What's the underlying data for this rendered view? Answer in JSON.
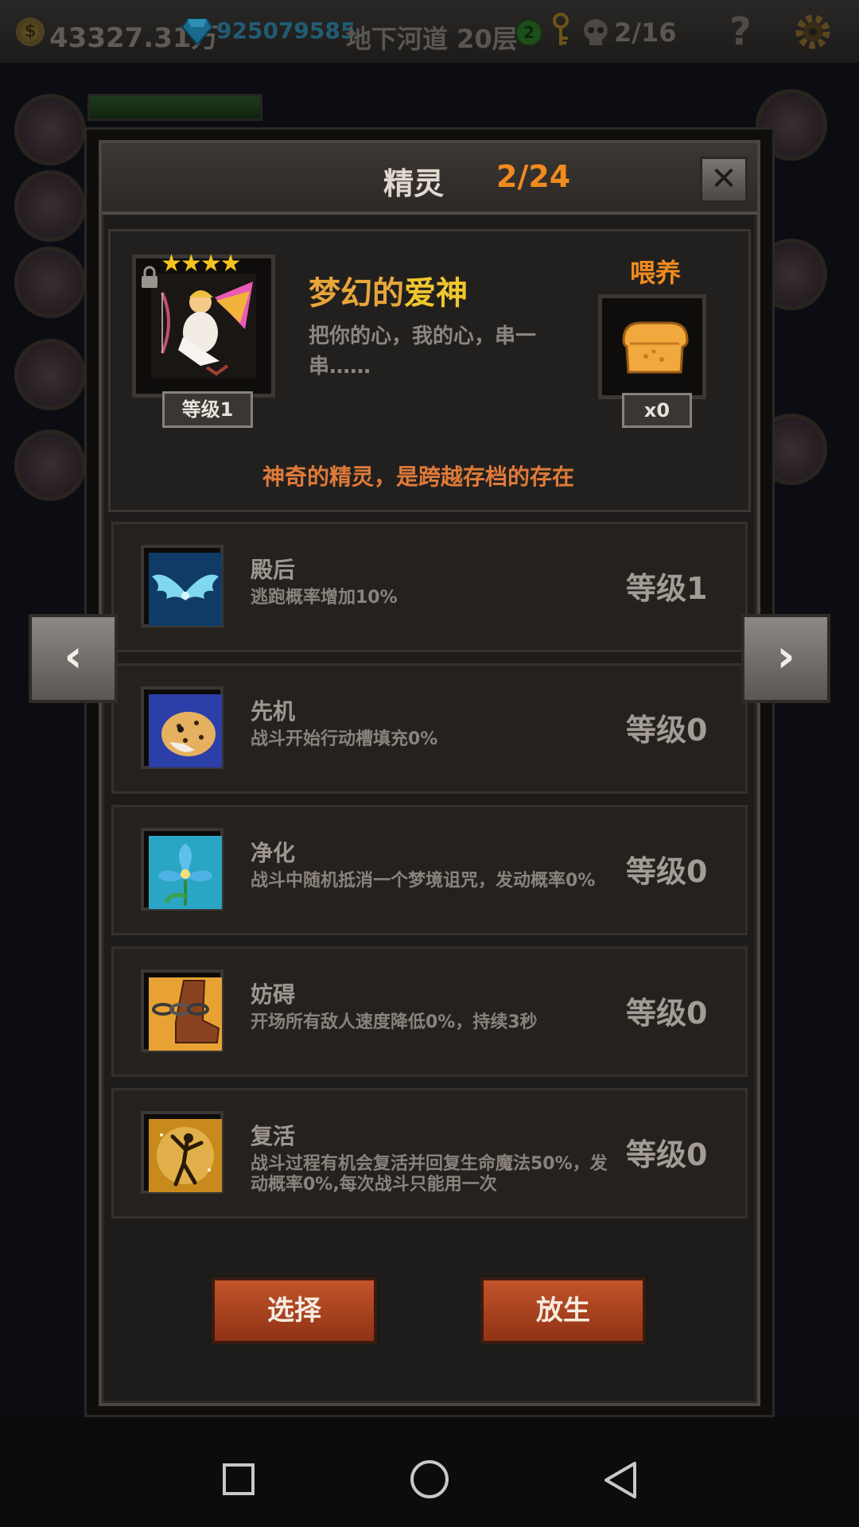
{
  "hud": {
    "coin_symbol": "$",
    "gold": "43327.31万",
    "gems": "925079585",
    "floor": "地下河道 20层",
    "badge_number": "2",
    "kills": "2/16",
    "help_symbol": "?"
  },
  "panel": {
    "title": "精灵",
    "count": "2/24",
    "close_symbol": "✕"
  },
  "sprite": {
    "stars": "★★★★",
    "level_badge": "等级1",
    "name_prefix": "梦幻的",
    "name_suffix": "爱神",
    "description": "把你的心，我的心，串一串……",
    "feed_label": "喂养",
    "feed_count": "x0",
    "tagline": "神奇的精灵，是跨越存档的存在"
  },
  "skills": [
    {
      "name": "殿后",
      "desc": "逃跑概率增加10%",
      "level": "等级1",
      "icon": "wings-icon"
    },
    {
      "name": "先机",
      "desc": "战斗开始行动槽填充0%",
      "level": "等级0",
      "icon": "leopard-icon"
    },
    {
      "name": "净化",
      "desc": "战斗中随机抵消一个梦境诅咒，发动概率0%",
      "level": "等级0",
      "icon": "flower-icon"
    },
    {
      "name": "妨碍",
      "desc": "开场所有敌人速度降低0%，持续3秒",
      "level": "等级0",
      "icon": "chained-boot-icon"
    },
    {
      "name": "复活",
      "desc": "战斗过程有机会复活并回复生命魔法50%，发动概率0%,每次战斗只能用一次",
      "level": "等级0",
      "icon": "resurrection-icon"
    }
  ],
  "nav": {
    "prev_symbol": "‹",
    "next_symbol": "›"
  },
  "actions": {
    "select": "选择",
    "release": "放生"
  },
  "colors": {
    "accent": "#f08b1d",
    "button": "#b3461f",
    "panel": "#1e1c1b"
  }
}
